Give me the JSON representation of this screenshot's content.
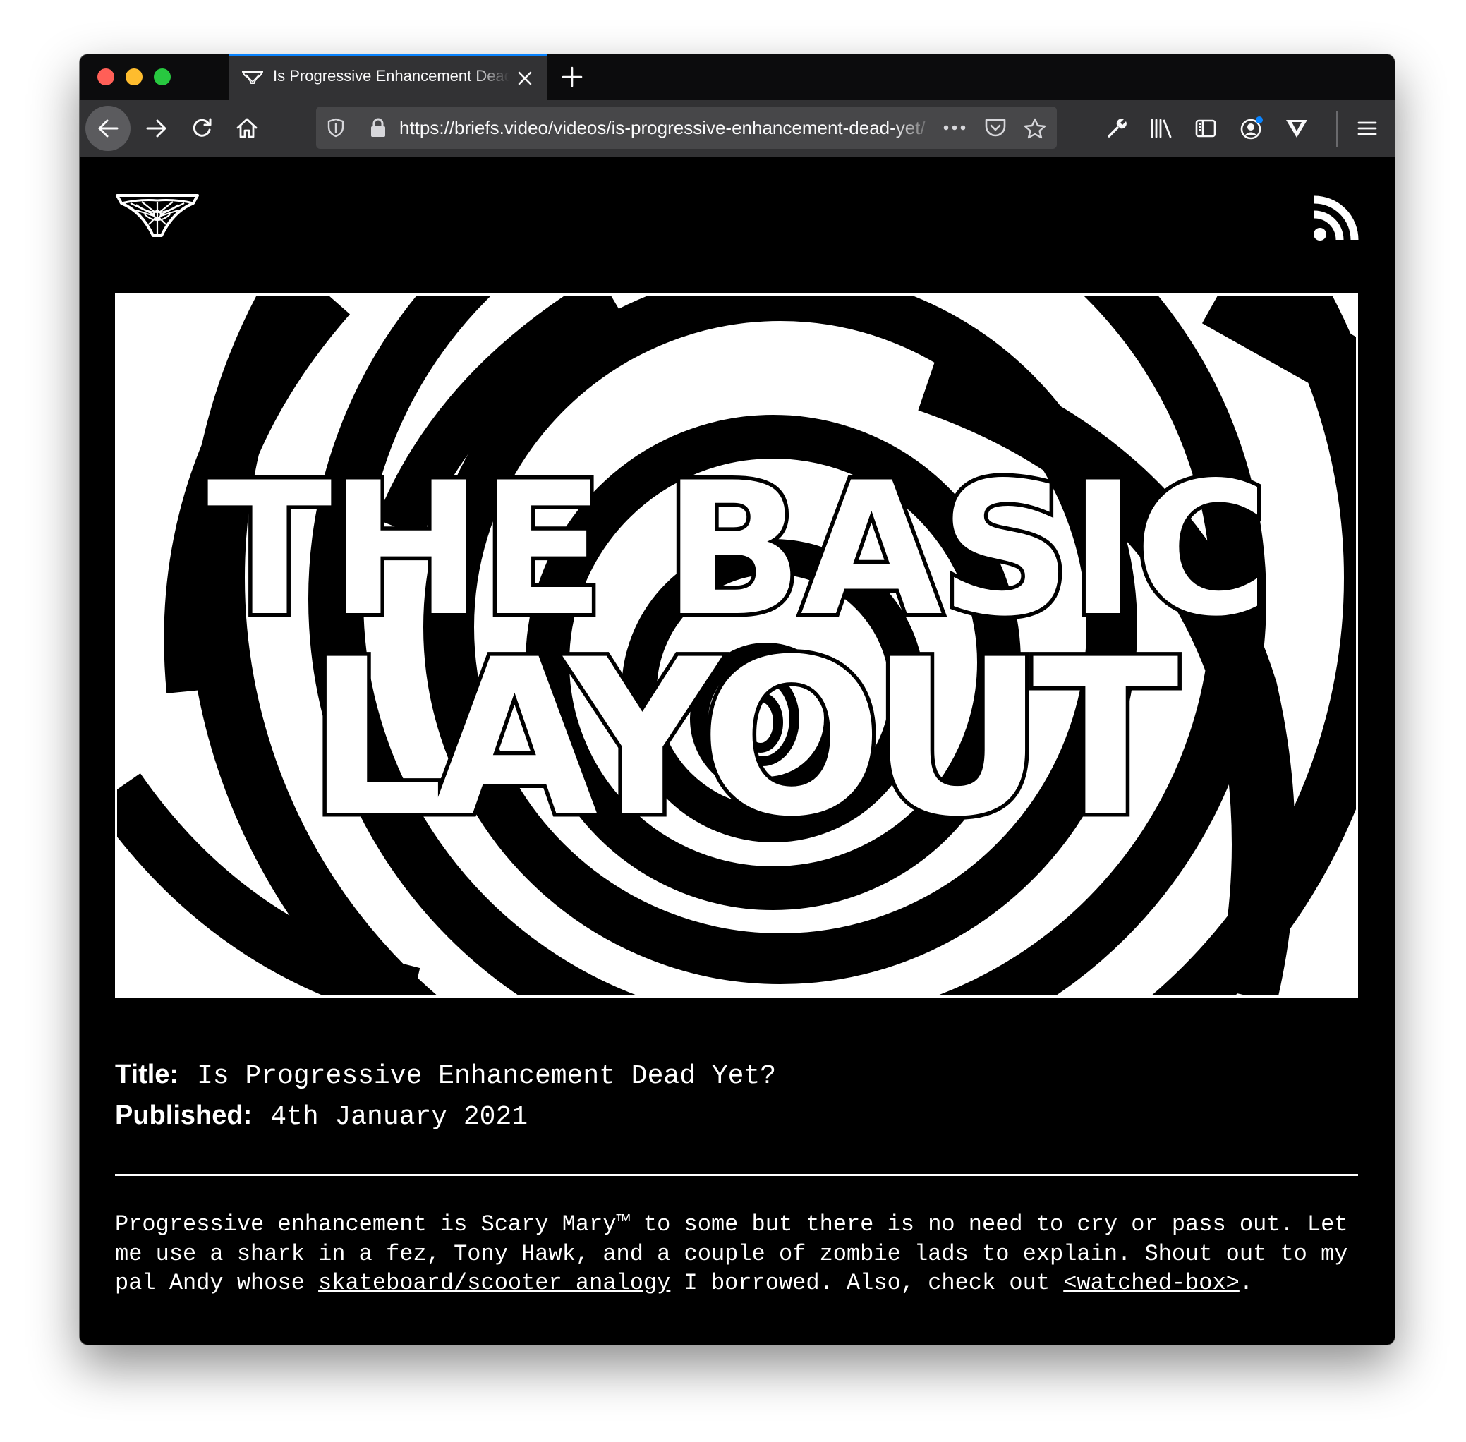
{
  "browser": {
    "tab_title": "Is Progressive Enhancement Dead Yet?",
    "url": "https://briefs.video/videos/is-progressive-enhancement-dead-yet/",
    "new_tab_label": "+",
    "icons": [
      "back-icon",
      "forward-icon",
      "reload-icon",
      "home-icon",
      "shield-icon",
      "lock-icon",
      "more-icon",
      "pocket-icon",
      "bookmark-star-icon",
      "wrench-icon",
      "library-icon",
      "sidebar-icon",
      "account-icon",
      "extension-v-icon",
      "menu-icon"
    ]
  },
  "site": {
    "logo": "briefs-logo",
    "feed_icon": "rss-icon"
  },
  "hero": {
    "line1": "THE BASIC",
    "line2": "LAYOUT"
  },
  "meta": {
    "title_label": "Title:",
    "title_value": "Is Progressive Enhancement Dead Yet?",
    "published_label": "Published:",
    "published_value": "4th January 2021"
  },
  "description": {
    "part1": "Progressive enhancement is Scary Mary™ to some but there is no need to cry or pass out. Let me use a shark in a fez, Tony Hawk, and a couple of zombie lads to explain. Shout out to my pal Andy whose ",
    "link1": "skateboard/scooter analogy",
    "part2": " I borrowed. Also, check out ",
    "link2": "<watched-box>",
    "part3": "."
  },
  "colors": {
    "page_bg": "#000000",
    "text": "#ffffff",
    "chrome_dark": "#0c0c0d",
    "chrome_toolbar": "#323234",
    "tab_accent": "#0a84ff"
  }
}
